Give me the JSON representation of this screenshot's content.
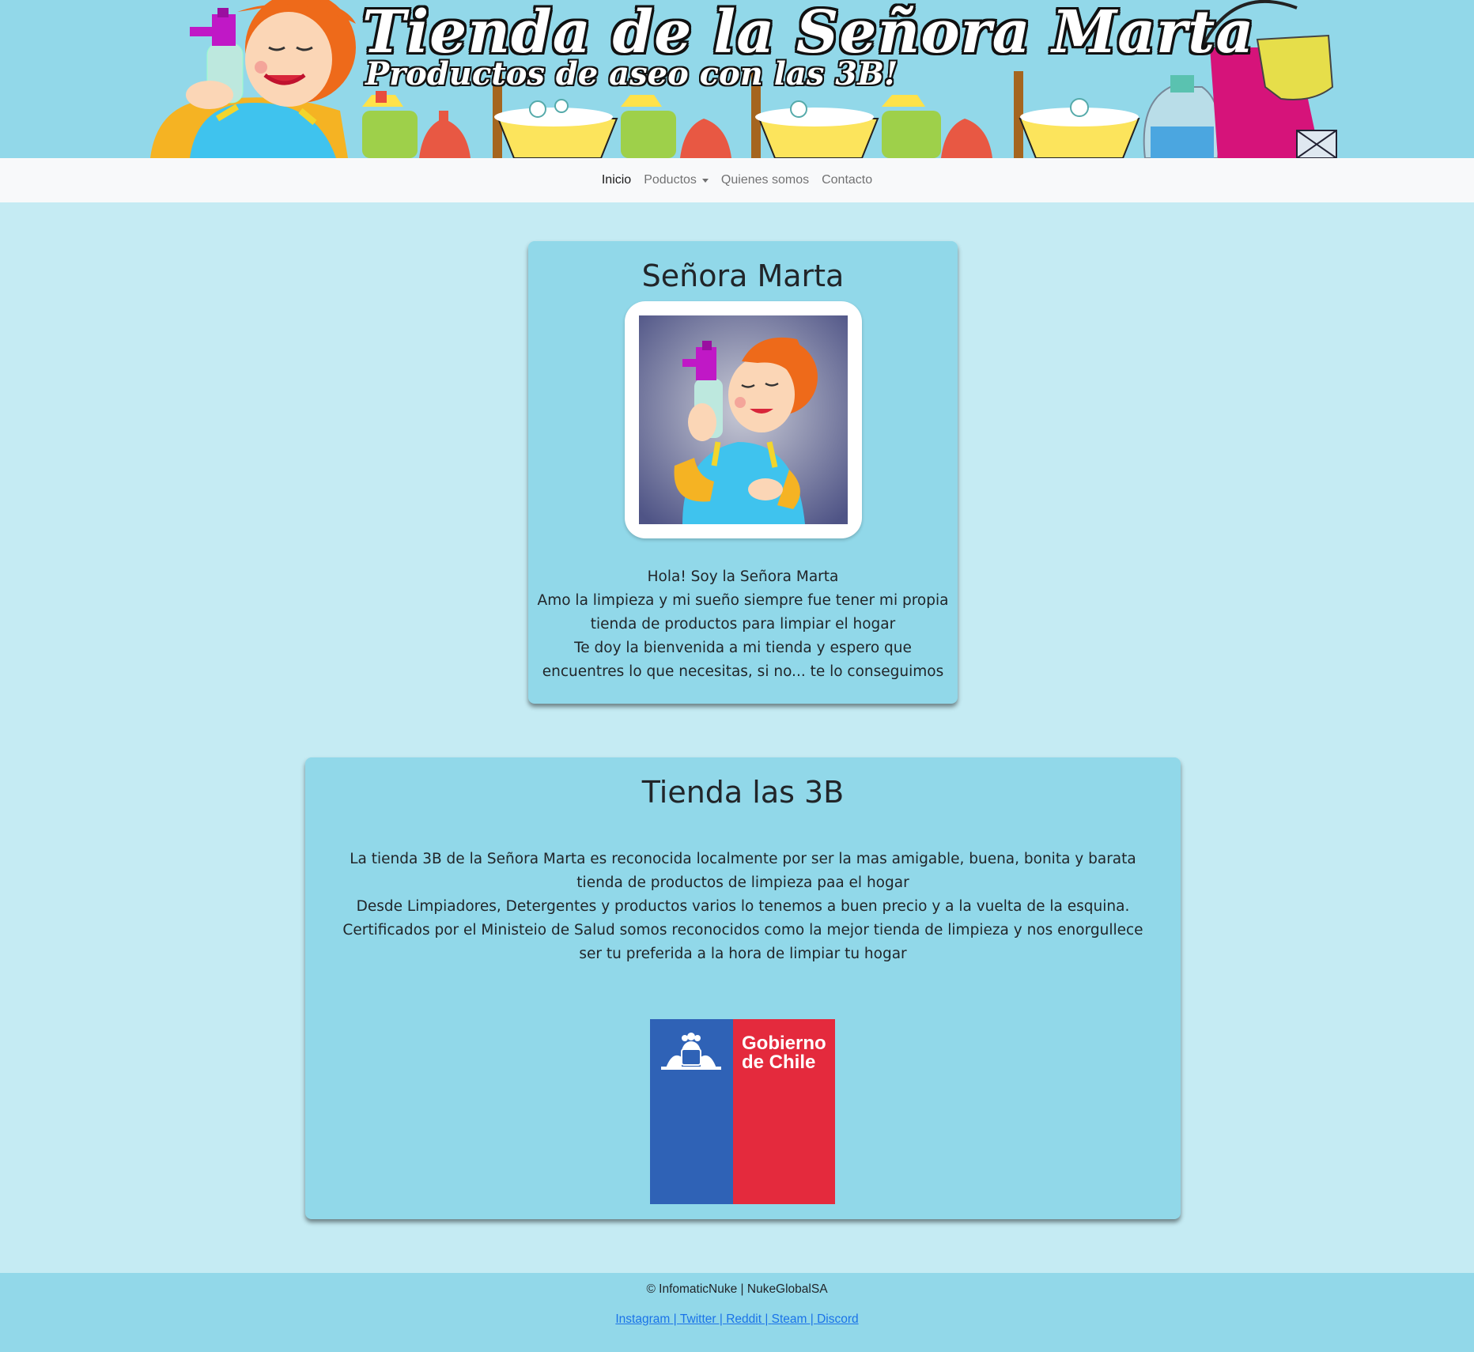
{
  "banner": {
    "title": "Tienda de la Señora Marta",
    "subtitle": "Productos de aseo con las 3B!"
  },
  "nav": {
    "items": [
      {
        "label": "Inicio",
        "active": true
      },
      {
        "label": "Poductos",
        "dropdown": true
      },
      {
        "label": "Quienes somos"
      },
      {
        "label": "Contacto"
      }
    ]
  },
  "card_marta": {
    "title": "Señora Marta",
    "lines": [
      "Hola! Soy la Señora Marta",
      "Amo la limpieza y mi sueño siempre fue tener mi propia tienda de productos para limpiar el hogar",
      "Te doy la bienvenida a mi tienda y espero que encuentres lo que necesitas, si no... te lo conseguimos"
    ]
  },
  "card_tienda": {
    "title": "Tienda las 3B",
    "lines": [
      "La tienda 3B de la Señora Marta es reconocida localmente por ser la mas amigable, buena, bonita y barata tienda de productos de limpieza paa el hogar",
      "Desde Limpiadores, Detergentes y productos varios lo tenemos a buen precio y a la vuelta de la esquina.",
      "Certificados por el Ministeio de Salud somos reconocidos como la mejor tienda de limpieza y nos enorgullece ser tu preferida a la hora de limpiar tu hogar"
    ],
    "logo_text": [
      "Gobierno",
      "de Chile"
    ],
    "logo_colors": {
      "blue": "#2f62b6",
      "red": "#e42a3d"
    }
  },
  "footer": {
    "copyright": "© InfomaticNuke | NukeGlobalSA",
    "links": [
      "Instagram",
      "Twitter",
      "Reddit",
      "Steam",
      "Discord"
    ]
  },
  "colors": {
    "background": "#c5ebf3",
    "card": "#91d8e9",
    "navbar": "#f8f9fa",
    "link": "#1a73e8"
  }
}
